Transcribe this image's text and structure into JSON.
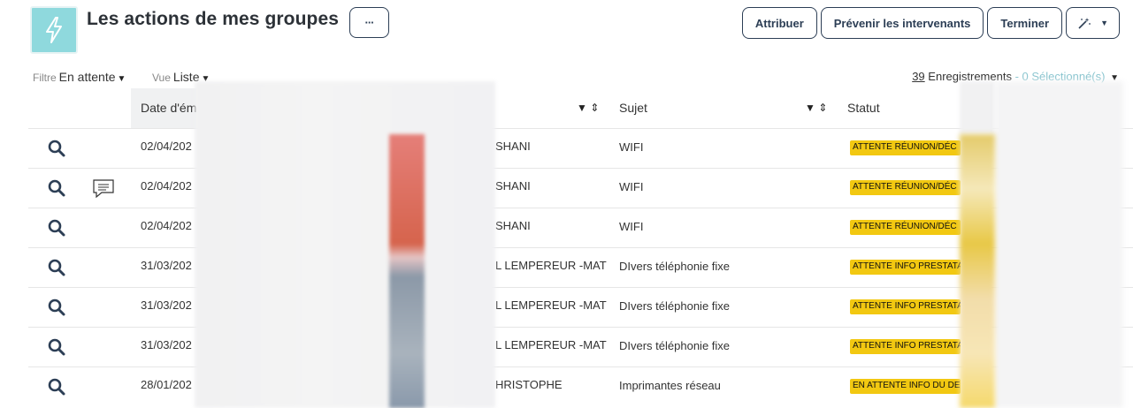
{
  "header": {
    "title": "Les actions de mes groupes",
    "more_label": "···",
    "buttons": [
      "Attribuer",
      "Prévenir les intervenants",
      "Terminer"
    ]
  },
  "filters": {
    "filtre_label": "Filtre",
    "filtre_value": "En attente",
    "vue_label": "Vue",
    "vue_value": "Liste"
  },
  "records": {
    "count": "39",
    "label": "Enregistrements",
    "selected": "- 0 Sélectionné(s)"
  },
  "table": {
    "headers": {
      "date": "Date d'ém",
      "sujet": "Sujet",
      "statut": "Statut"
    },
    "rows": [
      {
        "date": "02/04/202",
        "person": "SHANI",
        "sujet": "WIFI",
        "statut": "ATTENTE RÉUNION/DÉC",
        "comment": false
      },
      {
        "date": "02/04/202",
        "person": "SHANI",
        "sujet": "WIFI",
        "statut": "ATTENTE RÉUNION/DÉC",
        "comment": true
      },
      {
        "date": "02/04/202",
        "person": "SHANI",
        "sujet": "WIFI",
        "statut": "ATTENTE RÉUNION/DÉC",
        "comment": false
      },
      {
        "date": "31/03/202",
        "person": "L LEMPEREUR -MAT",
        "sujet": "DIvers téléphonie fixe",
        "statut": "ATTENTE INFO PRESTATA",
        "comment": false
      },
      {
        "date": "31/03/202",
        "person": "L LEMPEREUR -MAT",
        "sujet": "DIvers téléphonie fixe",
        "statut": "ATTENTE INFO PRESTATA",
        "comment": false
      },
      {
        "date": "31/03/202",
        "person": "L LEMPEREUR -MAT",
        "sujet": "DIvers téléphonie fixe",
        "statut": "ATTENTE INFO PRESTATA",
        "comment": false
      },
      {
        "date": "28/01/202",
        "person": "HRISTOPHE",
        "sujet": "Imprimantes réseau",
        "statut": "EN ATTENTE INFO DU DE",
        "comment": false
      }
    ]
  },
  "colors": {
    "accent": "#2c3e55",
    "app_icon_bg": "#8fd9dd",
    "status_badge": "#f2c811",
    "selected_text": "#8cc6d0"
  },
  "icons": [
    "lightning-icon",
    "search-icon",
    "comment-icon",
    "magic-wand-icon",
    "filter-icon",
    "sort-icon"
  ]
}
